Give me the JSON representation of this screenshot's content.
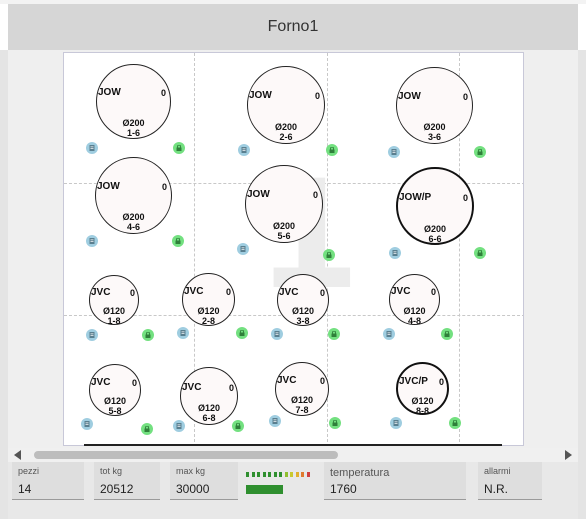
{
  "window": {
    "title": "Forno1"
  },
  "racks": [
    {
      "name": "JOW",
      "count": "0",
      "diameter": "Ø200",
      "position": "1-6",
      "selected": false
    },
    {
      "name": "JOW",
      "count": "0",
      "diameter": "Ø200",
      "position": "2-6",
      "selected": false
    },
    {
      "name": "JOW",
      "count": "0",
      "diameter": "Ø200",
      "position": "3-6",
      "selected": false
    },
    {
      "name": "JOW",
      "count": "0",
      "diameter": "Ø200",
      "position": "4-6",
      "selected": false
    },
    {
      "name": "JOW",
      "count": "0",
      "diameter": "Ø200",
      "position": "5-6",
      "selected": false
    },
    {
      "name": "JOW/P",
      "count": "0",
      "diameter": "Ø200",
      "position": "6-6",
      "selected": true
    },
    {
      "name": "JVC",
      "count": "0",
      "diameter": "Ø120",
      "position": "1-8",
      "selected": false
    },
    {
      "name": "JVC",
      "count": "0",
      "diameter": "Ø120",
      "position": "2-8",
      "selected": false
    },
    {
      "name": "JVC",
      "count": "0",
      "diameter": "Ø120",
      "position": "3-8",
      "selected": false
    },
    {
      "name": "JVC",
      "count": "0",
      "diameter": "Ø120",
      "position": "4-8",
      "selected": false
    },
    {
      "name": "JVC",
      "count": "0",
      "diameter": "Ø120",
      "position": "5-8",
      "selected": false
    },
    {
      "name": "JVC",
      "count": "0",
      "diameter": "Ø120",
      "position": "6-8",
      "selected": false
    },
    {
      "name": "JVC",
      "count": "0",
      "diameter": "Ø120",
      "position": "7-8",
      "selected": false
    },
    {
      "name": "JVC/P",
      "count": "0",
      "diameter": "Ø120",
      "position": "8-8",
      "selected": true
    }
  ],
  "icons": {
    "doc": "document-icon",
    "lock": "lock-icon"
  },
  "colors": {
    "doc_badge": "#9fcde0",
    "lock_badge": "#73e080",
    "gauge_fill": "#2f8f2f"
  },
  "footer": {
    "pezzi": {
      "label": "pezzi",
      "value": "14"
    },
    "tot_kg": {
      "label": "tot kg",
      "value": "20512"
    },
    "max_kg": {
      "label": "max kg",
      "value": "30000"
    },
    "load_fraction": 0.68,
    "temperatura": {
      "label": "temperatura",
      "value": "1760"
    },
    "allarmi": {
      "label": "allarmi",
      "value": "N.R."
    }
  }
}
